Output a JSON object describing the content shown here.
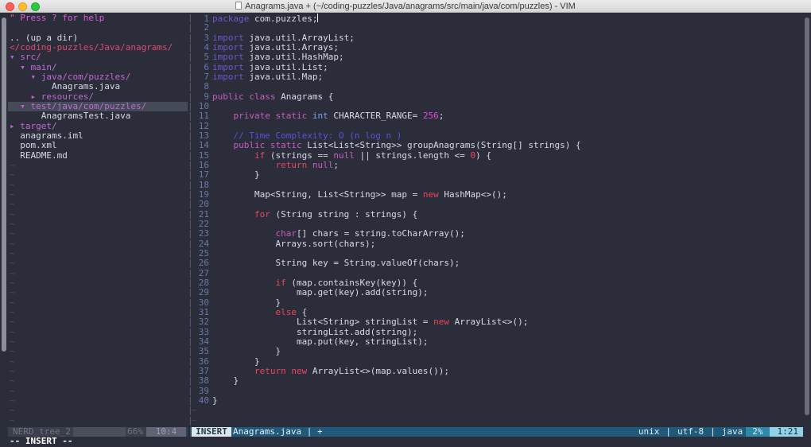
{
  "window": {
    "title": "Anagrams.java + (~/coding-puzzles/Java/anagrams/src/main/java/com/puzzles) - VIM"
  },
  "tree": {
    "help": "\" Press ? for help",
    "updir": ".. (up a dir)",
    "root": "</coding-puzzles/Java/anagrams/",
    "nodes": [
      {
        "indent": "",
        "arrow": "▾",
        "name": "src/",
        "kind": "dir"
      },
      {
        "indent": "  ",
        "arrow": "▾",
        "name": "main/",
        "kind": "dir"
      },
      {
        "indent": "    ",
        "arrow": "▾",
        "name": "java/com/puzzles/",
        "kind": "dir"
      },
      {
        "indent": "        ",
        "arrow": "",
        "name": "Anagrams.java",
        "kind": "file"
      },
      {
        "indent": "    ",
        "arrow": "▸",
        "name": "resources/",
        "kind": "dir"
      },
      {
        "indent": "  ",
        "arrow": "▾",
        "name": "test/java/com/puzzles/",
        "kind": "dir",
        "selected": true
      },
      {
        "indent": "      ",
        "arrow": "",
        "name": "AnagramsTest.java",
        "kind": "file"
      },
      {
        "indent": "",
        "arrow": "▸",
        "name": "target/",
        "kind": "dir"
      },
      {
        "indent": "  ",
        "arrow": "",
        "name": "anagrams.iml",
        "kind": "file"
      },
      {
        "indent": "  ",
        "arrow": "",
        "name": "pom.xml",
        "kind": "file"
      },
      {
        "indent": "  ",
        "arrow": "",
        "name": "README.md",
        "kind": "file"
      }
    ],
    "tilde": "~",
    "split_char": "|"
  },
  "editor": {
    "lines": [
      [
        [
          "faint",
          "package"
        ],
        [
          "plain",
          " com.puzzles;"
        ],
        [
          "cursor",
          ""
        ]
      ],
      [],
      [
        [
          "faint",
          "import"
        ],
        [
          "plain",
          " java.util.ArrayList;"
        ]
      ],
      [
        [
          "faint",
          "import"
        ],
        [
          "plain",
          " java.util.Arrays;"
        ]
      ],
      [
        [
          "faint",
          "import"
        ],
        [
          "plain",
          " java.util.HashMap;"
        ]
      ],
      [
        [
          "faint",
          "import"
        ],
        [
          "plain",
          " java.util.List;"
        ]
      ],
      [
        [
          "faint",
          "import"
        ],
        [
          "plain",
          " java.util.Map;"
        ]
      ],
      [],
      [
        [
          "kw",
          "public class"
        ],
        [
          "plain",
          " Anagrams {"
        ]
      ],
      [],
      [
        [
          "plain",
          "    "
        ],
        [
          "kw",
          "private static"
        ],
        [
          "plain",
          " "
        ],
        [
          "type",
          "int"
        ],
        [
          "plain",
          " CHARACTER_RANGE= "
        ],
        [
          "num",
          "256"
        ],
        [
          "plain",
          ";"
        ]
      ],
      [],
      [
        [
          "plain",
          "    "
        ],
        [
          "comment",
          "// Time Complexity: O (n log n )"
        ]
      ],
      [
        [
          "plain",
          "    "
        ],
        [
          "kw",
          "public static"
        ],
        [
          "plain",
          " List<List<String>> groupAnagrams(String[] strings) {"
        ]
      ],
      [
        [
          "plain",
          "        "
        ],
        [
          "red",
          "if"
        ],
        [
          "plain",
          " (strings == "
        ],
        [
          "kw",
          "null"
        ],
        [
          "plain",
          " || strings.length <= "
        ],
        [
          "red",
          "0"
        ],
        [
          "plain",
          ") {"
        ]
      ],
      [
        [
          "plain",
          "            "
        ],
        [
          "red",
          "return"
        ],
        [
          "plain",
          " "
        ],
        [
          "kw",
          "null"
        ],
        [
          "plain",
          ";"
        ]
      ],
      [
        [
          "plain",
          "        }"
        ]
      ],
      [],
      [
        [
          "plain",
          "        Map<String, List<String>> map = "
        ],
        [
          "red",
          "new"
        ],
        [
          "plain",
          " HashMap<>();"
        ]
      ],
      [],
      [
        [
          "plain",
          "        "
        ],
        [
          "red",
          "for"
        ],
        [
          "plain",
          " (String string : strings) {"
        ]
      ],
      [],
      [
        [
          "plain",
          "            "
        ],
        [
          "kw",
          "char"
        ],
        [
          "plain",
          "[] chars = string.toCharArray();"
        ]
      ],
      [
        [
          "plain",
          "            Arrays.sort(chars);"
        ]
      ],
      [],
      [
        [
          "plain",
          "            String key = String.valueOf(chars);"
        ]
      ],
      [],
      [
        [
          "plain",
          "            "
        ],
        [
          "red",
          "if"
        ],
        [
          "plain",
          " (map.containsKey(key)) {"
        ]
      ],
      [
        [
          "plain",
          "                map.get(key).add(string);"
        ]
      ],
      [
        [
          "plain",
          "            }"
        ]
      ],
      [
        [
          "plain",
          "            "
        ],
        [
          "red",
          "else"
        ],
        [
          "plain",
          " {"
        ]
      ],
      [
        [
          "plain",
          "                List<String> stringList = "
        ],
        [
          "red",
          "new"
        ],
        [
          "plain",
          " ArrayList<>();"
        ]
      ],
      [
        [
          "plain",
          "                stringList.add(string);"
        ]
      ],
      [
        [
          "plain",
          "                map.put(key, stringList);"
        ]
      ],
      [
        [
          "plain",
          "            }"
        ]
      ],
      [
        [
          "plain",
          "        }"
        ]
      ],
      [
        [
          "plain",
          "        "
        ],
        [
          "red",
          "return"
        ],
        [
          "plain",
          " "
        ],
        [
          "red",
          "new"
        ],
        [
          "plain",
          " ArrayList<>(map.values());"
        ]
      ],
      [
        [
          "plain",
          "    }"
        ]
      ],
      [],
      [
        [
          "plain",
          "}"
        ]
      ]
    ],
    "tilde": "~"
  },
  "status_left": {
    "name": "NERD_tree_2",
    "percent": "66%",
    "position": "10:4"
  },
  "status_right": {
    "mode": "INSERT",
    "filename": "Anagrams.java  |  +",
    "fileformat": "unix",
    "encoding": "utf-8",
    "filetype": "java",
    "percent": "2%",
    "position": "1:21"
  },
  "cmdline": "-- INSERT --"
}
